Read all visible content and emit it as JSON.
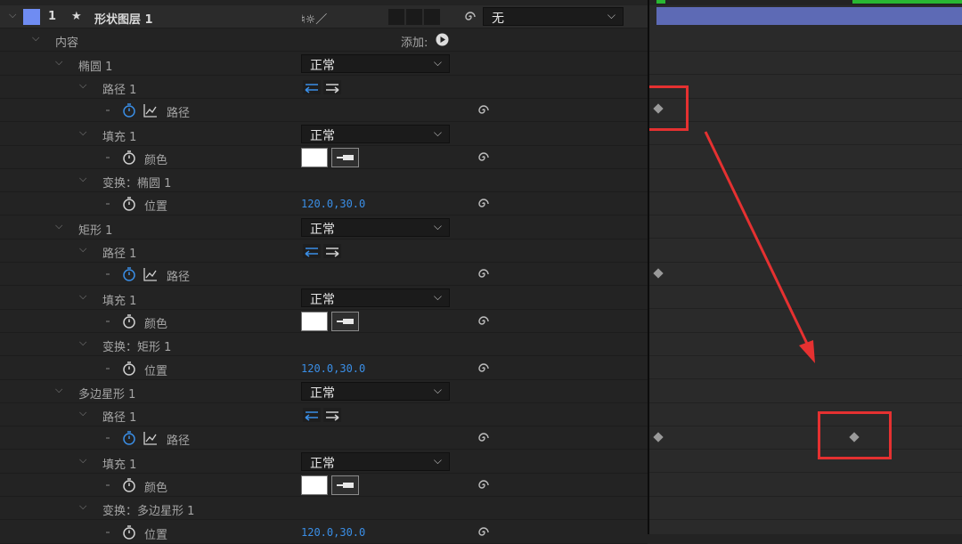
{
  "layer": {
    "index": "1",
    "star": "★",
    "name": "形状图层 1",
    "switch_icons": "♮☼／",
    "parent_value": "无",
    "color": "#6f8cf2"
  },
  "content": {
    "label": "内容",
    "add_label": "添加:"
  },
  "groups": [
    {
      "name": "椭圆 1",
      "blend": "正常",
      "path_label": "路径 1",
      "path_prop": "路径",
      "fill_label": "填充 1",
      "fill_blend": "正常",
      "color_label": "颜色",
      "transform_label": "变换：椭圆 1",
      "position_label": "位置",
      "position_value": "120.0,30.0"
    },
    {
      "name": "矩形 1",
      "blend": "正常",
      "path_label": "路径 1",
      "path_prop": "路径",
      "fill_label": "填充 1",
      "fill_blend": "正常",
      "color_label": "颜色",
      "transform_label": "变换：矩形 1",
      "position_label": "位置",
      "position_value": "120.0,30.0"
    },
    {
      "name": "多边星形 1",
      "blend": "正常",
      "path_label": "路径 1",
      "path_prop": "路径",
      "fill_label": "填充 1",
      "fill_blend": "正常",
      "color_label": "颜色",
      "transform_label": "变换：多边星形 1",
      "position_label": "位置",
      "position_value": "120.0,30.0"
    }
  ],
  "colors": {
    "accent_blue": "#3a8ee6",
    "highlight_red": "#e53131",
    "layer_bar": "#5d6ab5",
    "work_area_green": "#29b832"
  }
}
